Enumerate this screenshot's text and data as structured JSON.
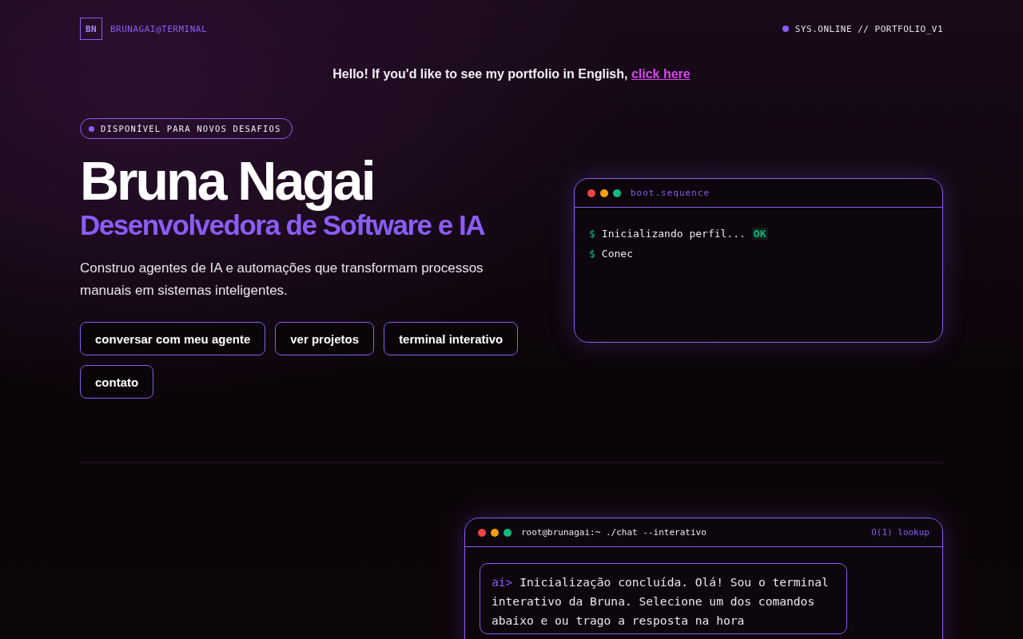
{
  "header": {
    "logo": "BN",
    "handle": "BRUNAGAI@TERMINAL",
    "status": "SYS.ONLINE // PORTFOLIO_V1"
  },
  "banner": {
    "text": "Hello! If you'd like to see my portfolio in English,",
    "link": "click here"
  },
  "hero": {
    "badge": "DISPONÍVEL PARA NOVOS DESAFIOS",
    "name": "Bruna Nagai",
    "role": "Desenvolvedora de Software e IA",
    "description": "Construo agentes de IA e automações que transformam processos manuais em sistemas inteligentes.",
    "buttons": [
      "conversar com meu agente",
      "ver projetos",
      "terminal interativo",
      "contato"
    ]
  },
  "boot_window": {
    "title": "boot.sequence",
    "lines": [
      {
        "prompt": "$",
        "text": "Inicializando perfil...",
        "status": "OK"
      },
      {
        "prompt": "$",
        "text": "Conec"
      }
    ]
  },
  "chat_window": {
    "title": "root@brunagai:~ ./chat --interativo",
    "meta": "O(1) lookup",
    "message": {
      "prompt": "ai>",
      "text": "Inicialização concluída. Olá! Sou o terminal interativo da Bruna. Selecione um dos comandos abaixo e ou trago a resposta na hora"
    }
  }
}
